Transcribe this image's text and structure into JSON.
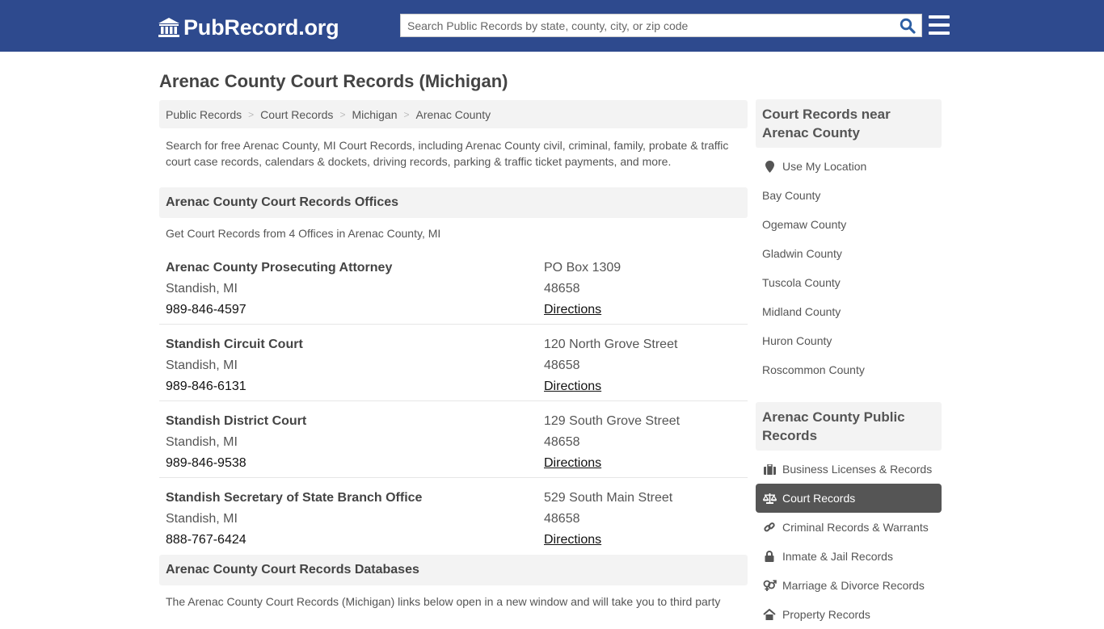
{
  "header": {
    "logo_text": "PubRecord.org",
    "search_placeholder": "Search Public Records by state, county, city, or zip code"
  },
  "page_title": "Arenac County Court Records (Michigan)",
  "breadcrumb": [
    "Public Records",
    "Court Records",
    "Michigan",
    "Arenac County"
  ],
  "intro": "Search for free Arenac County, MI Court Records, including Arenac County civil, criminal, family, probate & traffic court case records, calendars & dockets, driving records, parking & traffic ticket payments, and more.",
  "offices_section": {
    "title": "Arenac County Court Records Offices",
    "note": "Get Court Records from 4 Offices in Arenac County, MI",
    "offices": [
      {
        "name": "Arenac County Prosecuting Attorney",
        "city": "Standish, MI",
        "phone": "989-846-4597",
        "address": "PO Box 1309",
        "zip": "48658",
        "directions": "Directions"
      },
      {
        "name": "Standish Circuit Court",
        "city": "Standish, MI",
        "phone": "989-846-6131",
        "address": "120 North Grove Street",
        "zip": "48658",
        "directions": "Directions"
      },
      {
        "name": "Standish District Court",
        "city": "Standish, MI",
        "phone": "989-846-9538",
        "address": "129 South Grove Street",
        "zip": "48658",
        "directions": "Directions"
      },
      {
        "name": "Standish Secretary of State Branch Office",
        "city": "Standish, MI",
        "phone": "888-767-6424",
        "address": "529 South Main Street",
        "zip": "48658",
        "directions": "Directions"
      }
    ]
  },
  "databases_section": {
    "title": "Arenac County Court Records Databases",
    "intro": "The Arenac County Court Records (Michigan) links below open in a new window and will take you to third party"
  },
  "sidebar": {
    "nearby_title": "Court Records near Arenac County",
    "use_location": "Use My Location",
    "nearby": [
      "Bay County",
      "Ogemaw County",
      "Gladwin County",
      "Tuscola County",
      "Midland County",
      "Huron County",
      "Roscommon County"
    ],
    "public_title": "Arenac County Public Records",
    "public": [
      {
        "label": "Business Licenses & Records",
        "icon": "briefcase-icon",
        "active": false
      },
      {
        "label": "Court Records",
        "icon": "scales-icon",
        "active": true
      },
      {
        "label": "Criminal Records & Warrants",
        "icon": "link-icon",
        "active": false
      },
      {
        "label": "Inmate & Jail Records",
        "icon": "lock-icon",
        "active": false
      },
      {
        "label": "Marriage & Divorce Records",
        "icon": "gender-icon",
        "active": false
      },
      {
        "label": "Property Records",
        "icon": "home-icon",
        "active": false
      }
    ]
  }
}
